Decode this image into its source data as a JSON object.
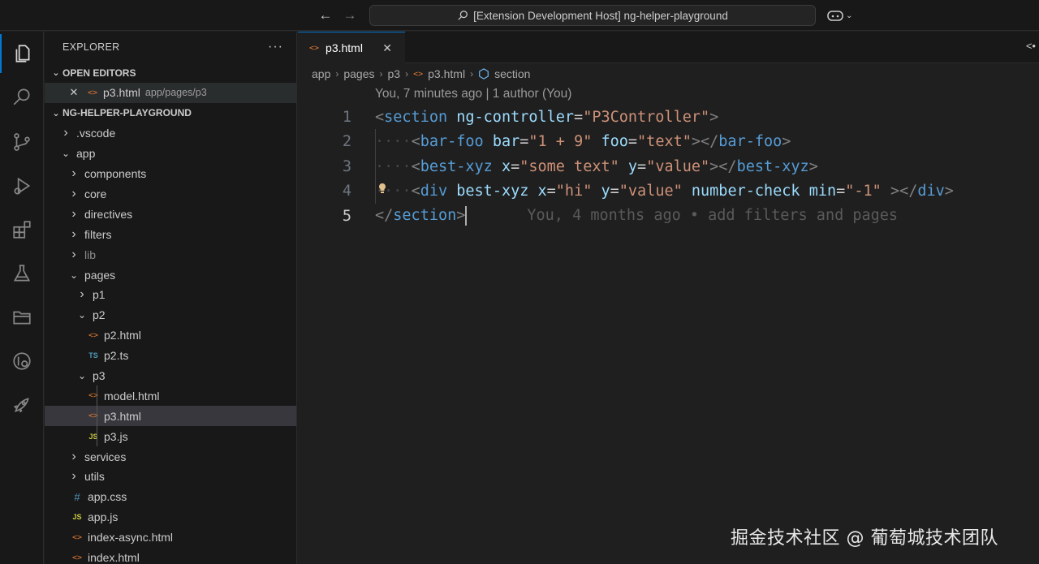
{
  "titlebar": {
    "back_icon": "arrow-left-icon",
    "forward_icon": "arrow-right-icon",
    "command_center": "[Extension Development Host] ng-helper-playground",
    "copilot_icon": "copilot-icon"
  },
  "activitybar": {
    "items": [
      "explorer-icon",
      "search-icon",
      "source-control-icon",
      "run-debug-icon",
      "extensions-icon",
      "testing-icon",
      "folders-icon",
      "remote-explorer-icon",
      "rocket-icon"
    ]
  },
  "sidebar": {
    "title": "EXPLORER",
    "more": "···",
    "open_editors": {
      "header": "OPEN EDITORS",
      "items": [
        {
          "name": "p3.html",
          "path": "app/pages/p3"
        }
      ]
    },
    "workspace": {
      "header": "NG-HELPER-PLAYGROUND",
      "tree": [
        {
          "label": ".vscode",
          "kind": "folder",
          "depth": 0,
          "open": false
        },
        {
          "label": "app",
          "kind": "folder",
          "depth": 0,
          "open": true
        },
        {
          "label": "components",
          "kind": "folder",
          "depth": 1,
          "open": false
        },
        {
          "label": "core",
          "kind": "folder",
          "depth": 1,
          "open": false
        },
        {
          "label": "directives",
          "kind": "folder",
          "depth": 1,
          "open": false
        },
        {
          "label": "filters",
          "kind": "folder",
          "depth": 1,
          "open": false
        },
        {
          "label": "lib",
          "kind": "folder",
          "depth": 1,
          "open": false,
          "muted": true
        },
        {
          "label": "pages",
          "kind": "folder",
          "depth": 1,
          "open": true
        },
        {
          "label": "p1",
          "kind": "folder",
          "depth": 2,
          "open": false
        },
        {
          "label": "p2",
          "kind": "folder",
          "depth": 2,
          "open": true
        },
        {
          "label": "p2.html",
          "kind": "html",
          "depth": 3
        },
        {
          "label": "p2.ts",
          "kind": "ts",
          "depth": 3
        },
        {
          "label": "p3",
          "kind": "folder",
          "depth": 2,
          "open": true
        },
        {
          "label": "model.html",
          "kind": "html",
          "depth": 3
        },
        {
          "label": "p3.html",
          "kind": "html",
          "depth": 3,
          "selected": true
        },
        {
          "label": "p3.js",
          "kind": "js",
          "depth": 3
        },
        {
          "label": "services",
          "kind": "folder",
          "depth": 1,
          "open": false
        },
        {
          "label": "utils",
          "kind": "folder",
          "depth": 1,
          "open": false
        },
        {
          "label": "app.css",
          "kind": "css",
          "depth": 1
        },
        {
          "label": "app.js",
          "kind": "js",
          "depth": 1
        },
        {
          "label": "index-async.html",
          "kind": "html",
          "depth": 1
        },
        {
          "label": "index.html",
          "kind": "html",
          "depth": 1
        }
      ]
    }
  },
  "editor": {
    "tab": {
      "label": "p3.html",
      "close": "✕"
    },
    "breadcrumb": [
      "app",
      "pages",
      "p3",
      "p3.html",
      "section"
    ],
    "codelens": "You, 7 minutes ago | 1 author (You)",
    "line_numbers": [
      "1",
      "2",
      "3",
      "4",
      "5"
    ],
    "blame": "You, 4 months ago • add filters and pages",
    "code_text": {
      "l1": {
        "tag": "section",
        "attr": "ng-controller",
        "val": "\"P3Controller\""
      },
      "l2": {
        "tag": "bar-foo",
        "a1": "bar",
        "v1": "\"1 + 9\"",
        "a2": "foo",
        "v2": "\"text\"",
        "close": "bar-foo"
      },
      "l3": {
        "tag": "best-xyz",
        "a1": "x",
        "v1": "\"some text\"",
        "a2": "y",
        "v2": "\"value\"",
        "close": "best-xyz"
      },
      "l4": {
        "tag": "div",
        "a1": "best-xyz",
        "a2": "x",
        "v2": "\"hi\"",
        "a3": "y",
        "v3": "\"value\"",
        "a4": "number-check",
        "a5": "min",
        "v5": "\"-1\"",
        "close": "div"
      },
      "l5": {
        "close": "section"
      }
    }
  },
  "watermark": "掘金技术社区 @ 葡萄城技术团队",
  "colors": {
    "accent": "#0078d4",
    "tag": "#569cd6",
    "attr": "#9cdcfe",
    "string": "#ce9178"
  }
}
